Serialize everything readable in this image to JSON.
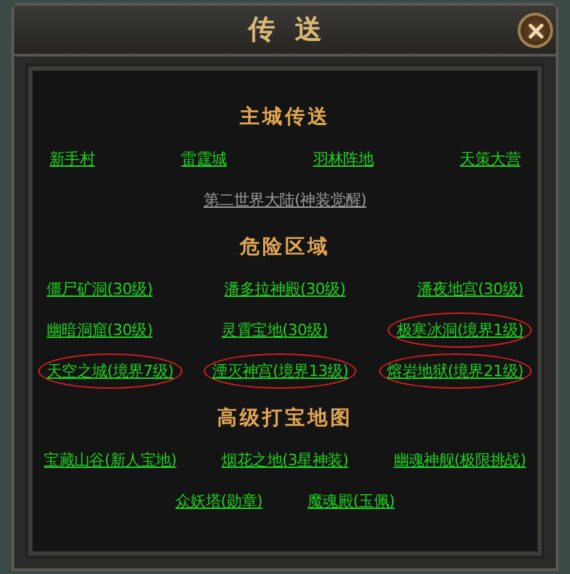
{
  "window": {
    "title": "传送"
  },
  "sections": [
    {
      "title": "主城传送",
      "kind": "spread",
      "lines": [
        {
          "links": [
            {
              "label": "新手村",
              "disabled": false,
              "circled": false
            },
            {
              "label": "雷霆城",
              "disabled": false,
              "circled": false
            },
            {
              "label": "羽林阵地",
              "disabled": false,
              "circled": false
            },
            {
              "label": "天策大营",
              "disabled": false,
              "circled": false
            }
          ]
        },
        {
          "links": [
            {
              "label": "第二世界大陆(神装觉醒)",
              "disabled": true,
              "circled": false
            }
          ]
        }
      ]
    },
    {
      "title": "危险区域",
      "kind": "columns",
      "lines": [
        {
          "links": [
            {
              "label": "僵尸矿洞(30级)",
              "disabled": false,
              "circled": false
            },
            {
              "label": "潘多拉神殿(30级)",
              "disabled": false,
              "circled": false
            },
            {
              "label": "潘夜地宫(30级)",
              "disabled": false,
              "circled": false
            }
          ]
        },
        {
          "links": [
            {
              "label": "幽暗洞窟(30级)",
              "disabled": false,
              "circled": false
            },
            {
              "label": "灵霄宝地(30级)",
              "disabled": false,
              "circled": false
            },
            {
              "label": "极寒冰洞(境界1级)",
              "disabled": false,
              "circled": true
            }
          ]
        },
        {
          "links": [
            {
              "label": "天空之城(境界7级)",
              "disabled": false,
              "circled": true
            },
            {
              "label": "湮灭神宫(境界13级)",
              "disabled": false,
              "circled": true
            },
            {
              "label": "熔岩地狱(境界21级)",
              "disabled": false,
              "circled": true
            }
          ]
        }
      ]
    },
    {
      "title": "高级打宝地图",
      "kind": "centered",
      "lines": [
        {
          "links": [
            {
              "label": "宝藏山谷(新人宝地)",
              "disabled": false,
              "circled": false
            },
            {
              "label": "烟花之地(3星神装)",
              "disabled": false,
              "circled": false
            },
            {
              "label": "幽魂神舰(极限挑战)",
              "disabled": false,
              "circled": false
            }
          ]
        },
        {
          "links": [
            {
              "label": "众妖塔(勋章)",
              "disabled": false,
              "circled": false
            },
            {
              "label": "魔魂殿(玉佩)",
              "disabled": false,
              "circled": false
            }
          ]
        }
      ]
    }
  ]
}
